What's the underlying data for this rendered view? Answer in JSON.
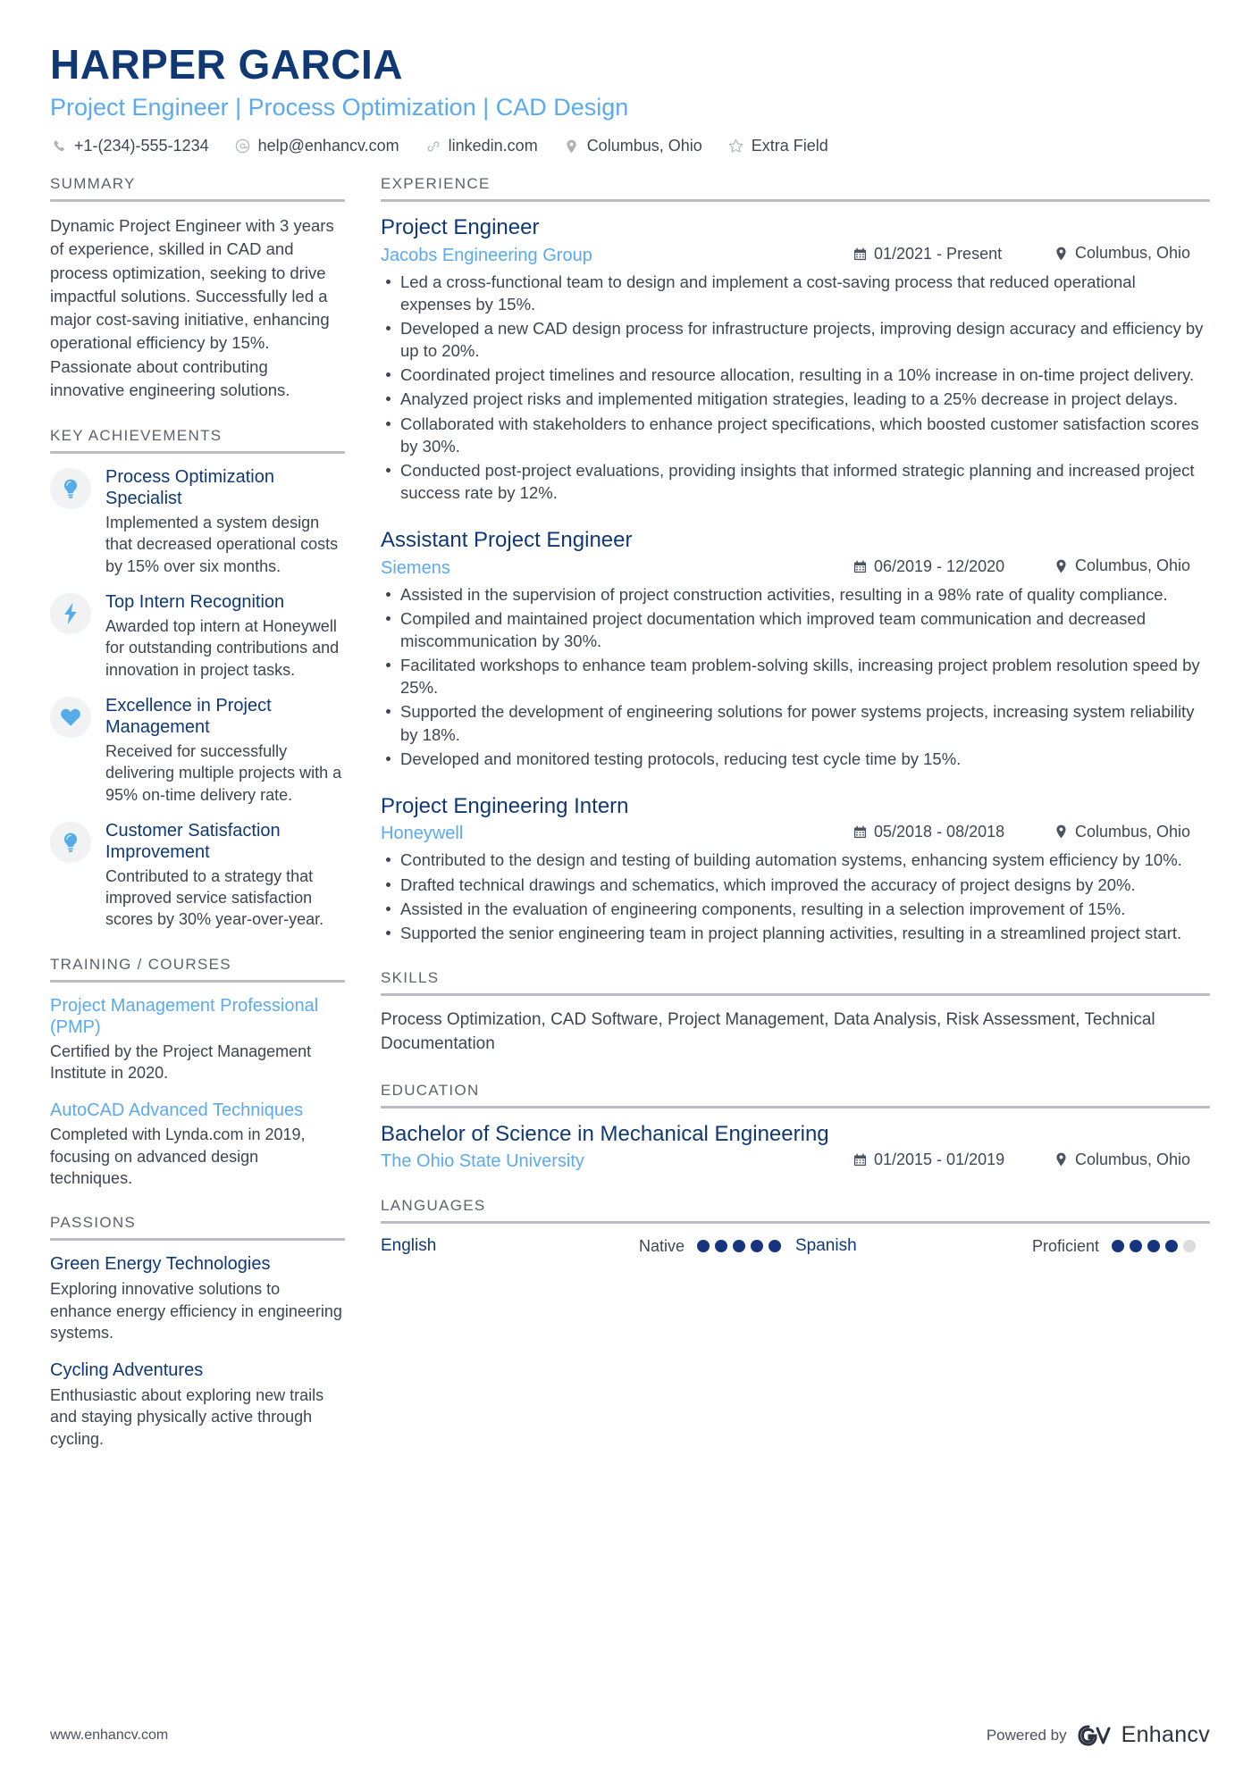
{
  "header": {
    "name": "HARPER GARCIA",
    "title": "Project Engineer | Process Optimization | CAD Design",
    "contacts": [
      {
        "icon": "phone-icon",
        "text": "+1-(234)-555-1234"
      },
      {
        "icon": "email-icon",
        "text": "help@enhancv.com"
      },
      {
        "icon": "link-icon",
        "text": "linkedin.com"
      },
      {
        "icon": "location-pin-icon",
        "text": "Columbus, Ohio"
      },
      {
        "icon": "star-icon",
        "text": "Extra Field"
      }
    ]
  },
  "colors": {
    "navy": "#0f3875",
    "light_blue": "#5aaaf0",
    "body_text": "#3d4650",
    "rule": "#b9bcc1",
    "dot_filled": "#17357f",
    "dot_empty": "#d9dbde"
  },
  "sidebar": {
    "summary": {
      "heading": "SUMMARY",
      "text": "Dynamic Project Engineer with 3 years of experience, skilled in CAD and process optimization, seeking to drive impactful solutions. Successfully led a major cost-saving initiative, enhancing operational efficiency by 15%. Passionate about contributing innovative engineering solutions."
    },
    "key_achievements": {
      "heading": "KEY ACHIEVEMENTS",
      "items": [
        {
          "icon": "lightbulb-icon",
          "title": "Process Optimization Specialist",
          "description": "Implemented a system design that decreased operational costs by 15% over six months."
        },
        {
          "icon": "lightning-bolt-icon",
          "title": "Top Intern Recognition",
          "description": "Awarded top intern at Honeywell for outstanding contributions and innovation in project tasks."
        },
        {
          "icon": "heart-icon",
          "title": "Excellence in Project Management",
          "description": "Received for successfully delivering multiple projects with a 95% on-time delivery rate."
        },
        {
          "icon": "lightbulb-icon",
          "title": "Customer Satisfaction Improvement",
          "description": "Contributed to a strategy that improved service satisfaction scores by 30% year-over-year."
        }
      ]
    },
    "training": {
      "heading": "TRAINING / COURSES",
      "items": [
        {
          "title": "Project Management Professional (PMP)",
          "description": "Certified by the Project Management Institute in 2020."
        },
        {
          "title": "AutoCAD Advanced Techniques",
          "description": "Completed with Lynda.com in 2019, focusing on advanced design techniques."
        }
      ]
    },
    "passions": {
      "heading": "PASSIONS",
      "items": [
        {
          "title": "Green Energy Technologies",
          "description": "Exploring innovative solutions to enhance energy efficiency in engineering systems."
        },
        {
          "title": "Cycling Adventures",
          "description": "Enthusiastic about exploring new trails and staying physically active through cycling."
        }
      ]
    }
  },
  "main": {
    "experience": {
      "heading": "EXPERIENCE",
      "jobs": [
        {
          "role": "Project Engineer",
          "company": "Jacobs Engineering Group",
          "dates": "01/2021 - Present",
          "location": "Columbus, Ohio",
          "bullets": [
            "Led a cross-functional team to design and implement a cost-saving process that reduced operational expenses by 15%.",
            "Developed a new CAD design process for infrastructure projects, improving design accuracy and efficiency by up to 20%.",
            "Coordinated project timelines and resource allocation, resulting in a 10% increase in on-time project delivery.",
            "Analyzed project risks and implemented mitigation strategies, leading to a 25% decrease in project delays.",
            "Collaborated with stakeholders to enhance project specifications, which boosted customer satisfaction scores by 30%.",
            "Conducted post-project evaluations, providing insights that informed strategic planning and increased project success rate by 12%."
          ]
        },
        {
          "role": "Assistant Project Engineer",
          "company": "Siemens",
          "dates": "06/2019 - 12/2020",
          "location": "Columbus, Ohio",
          "bullets": [
            "Assisted in the supervision of project construction activities, resulting in a 98% rate of quality compliance.",
            "Compiled and maintained project documentation which improved team communication and decreased miscommunication by 30%.",
            "Facilitated workshops to enhance team problem-solving skills, increasing project problem resolution speed by 25%.",
            "Supported the development of engineering solutions for power systems projects, increasing system reliability by 18%.",
            "Developed and monitored testing protocols, reducing test cycle time by 15%."
          ]
        },
        {
          "role": "Project Engineering Intern",
          "company": "Honeywell",
          "dates": "05/2018 - 08/2018",
          "location": "Columbus, Ohio",
          "bullets": [
            "Contributed to the design and testing of building automation systems, enhancing system efficiency by 10%.",
            "Drafted technical drawings and schematics, which improved the accuracy of project designs by 20%.",
            "Assisted in the evaluation of engineering components, resulting in a selection improvement of 15%.",
            "Supported the senior engineering team in project planning activities, resulting in a streamlined project start."
          ]
        }
      ]
    },
    "skills": {
      "heading": "SKILLS",
      "text": "Process Optimization, CAD Software, Project Management, Data Analysis, Risk Assessment, Technical Documentation"
    },
    "education": {
      "heading": "EDUCATION",
      "items": [
        {
          "degree": "Bachelor of Science in Mechanical Engineering",
          "school": "The Ohio State University",
          "dates": "01/2015 - 01/2019",
          "location": "Columbus, Ohio"
        }
      ]
    },
    "languages": {
      "heading": "LANGUAGES",
      "items": [
        {
          "name": "English",
          "level": "Native",
          "filled": 5,
          "total": 5
        },
        {
          "name": "Spanish",
          "level": "Proficient",
          "filled": 4,
          "total": 5
        }
      ]
    }
  },
  "footer": {
    "url": "www.enhancv.com",
    "powered_by": "Powered by",
    "brand": "Enhancv"
  }
}
